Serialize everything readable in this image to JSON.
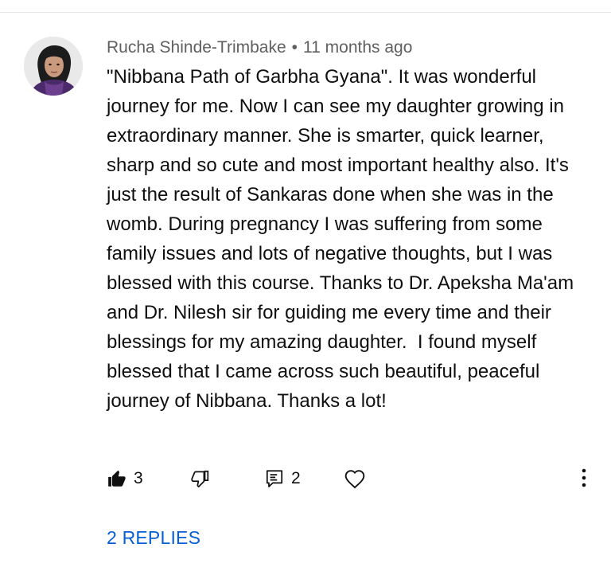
{
  "comment": {
    "author": "Rucha Shinde-Trimbake",
    "separator": "•",
    "timestamp": "11 months ago",
    "text": "\"Nibbana Path of Garbha Gyana\". It was wonderful journey for me. Now I can see my daughter growing in extraordinary manner. She is smarter, quick learner, sharp and so cute and most important healthy also. It's just the result of Sankaras done when she was in the womb. During pregnancy I was suffering from some family issues and lots of negative thoughts, but I was blessed with this course. Thanks to Dr. Apeksha Ma'am and Dr. Nilesh sir for guiding me every time and their blessings for my amazing daughter.  I found myself blessed that I came across such beautiful, peaceful journey of Nibbana. Thanks a lot!",
    "likes": "3",
    "reply_count": "2",
    "replies_link": "2 REPLIES"
  },
  "icons": {
    "like": "thumbs-up-icon",
    "dislike": "thumbs-down-icon",
    "reply": "comment-icon",
    "heart": "heart-icon",
    "more": "more-vertical-icon"
  },
  "colors": {
    "link": "#065fd4",
    "meta": "#606060",
    "text": "#0f0f0f"
  }
}
